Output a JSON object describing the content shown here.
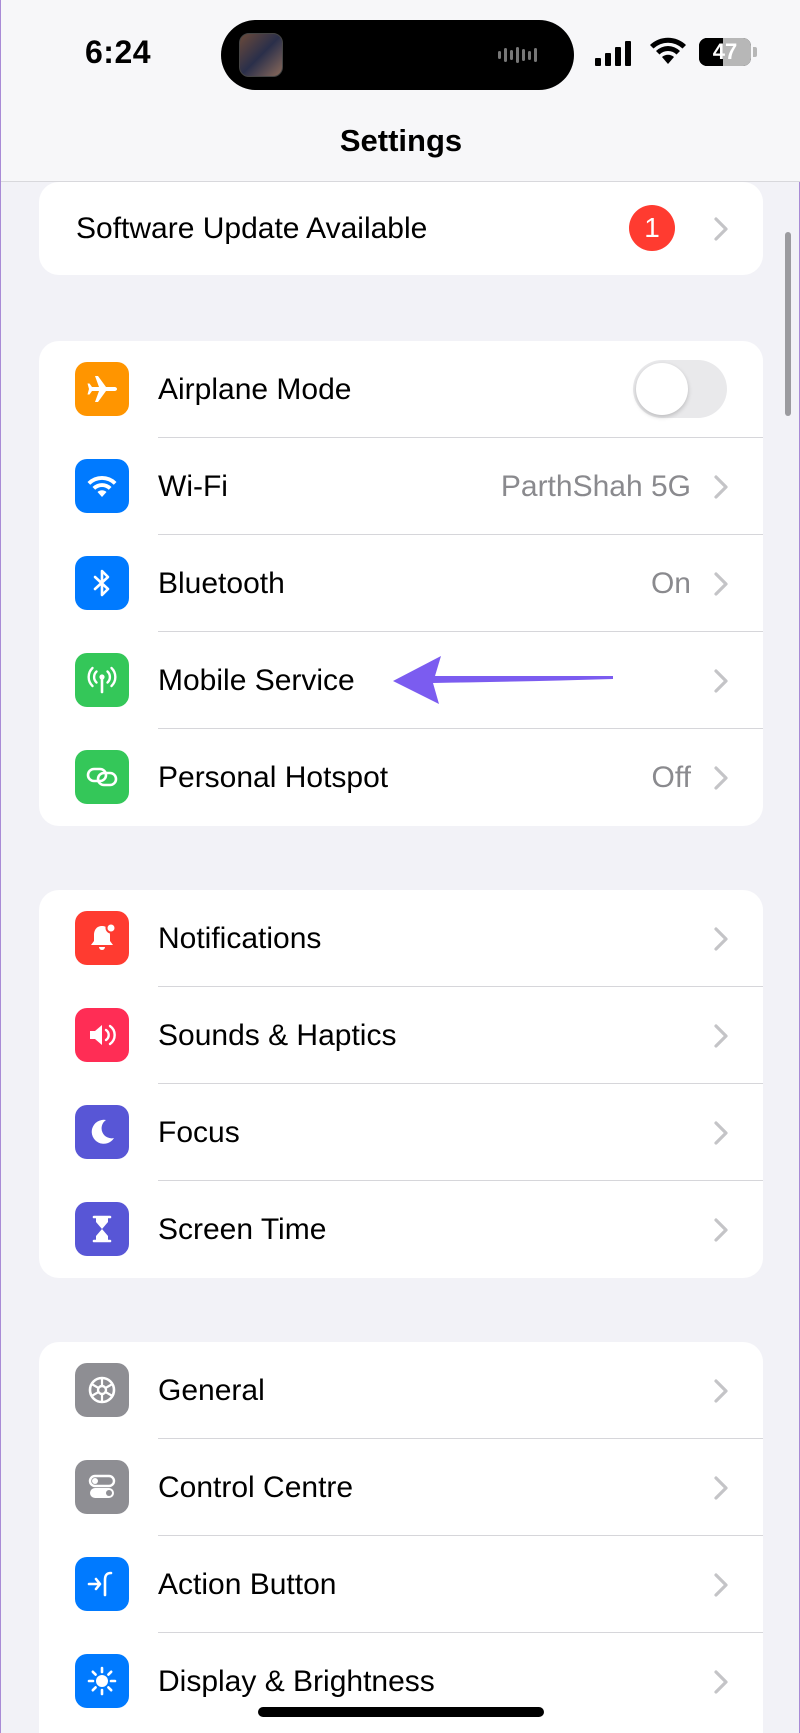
{
  "status_bar": {
    "time": "6:24",
    "battery_level": "47",
    "battery_fraction": 0.47
  },
  "header": {
    "title": "Settings"
  },
  "software_update": {
    "label": "Software Update Available",
    "badge_count": "1"
  },
  "connectivity": {
    "items": [
      {
        "label": "Airplane Mode",
        "icon": "airplane-icon",
        "color": "#ff9500",
        "toggle_on": false
      },
      {
        "label": "Wi-Fi",
        "icon": "wifi-icon",
        "color": "#007aff",
        "value": "ParthShah 5G"
      },
      {
        "label": "Bluetooth",
        "icon": "bluetooth-icon",
        "color": "#007aff",
        "value": "On"
      },
      {
        "label": "Mobile Service",
        "icon": "antenna-icon",
        "color": "#34c759",
        "value": ""
      },
      {
        "label": "Personal Hotspot",
        "icon": "hotspot-link-icon",
        "color": "#34c759",
        "value": "Off"
      }
    ]
  },
  "attention": {
    "items": [
      {
        "label": "Notifications",
        "icon": "bell-icon",
        "color": "#ff3b30"
      },
      {
        "label": "Sounds & Haptics",
        "icon": "speaker-icon",
        "color": "#ff2d55"
      },
      {
        "label": "Focus",
        "icon": "moon-icon",
        "color": "#5856d6"
      },
      {
        "label": "Screen Time",
        "icon": "hourglass-icon",
        "color": "#5856d6"
      }
    ]
  },
  "system": {
    "items": [
      {
        "label": "General",
        "icon": "gear-icon",
        "color": "#8e8e93"
      },
      {
        "label": "Control Centre",
        "icon": "toggles-icon",
        "color": "#8e8e93"
      },
      {
        "label": "Action Button",
        "icon": "action-button-icon",
        "color": "#007aff"
      },
      {
        "label": "Display & Brightness",
        "icon": "sun-icon",
        "color": "#007aff"
      }
    ]
  },
  "annotation": {
    "arrow_color": "#7b5cf0"
  }
}
